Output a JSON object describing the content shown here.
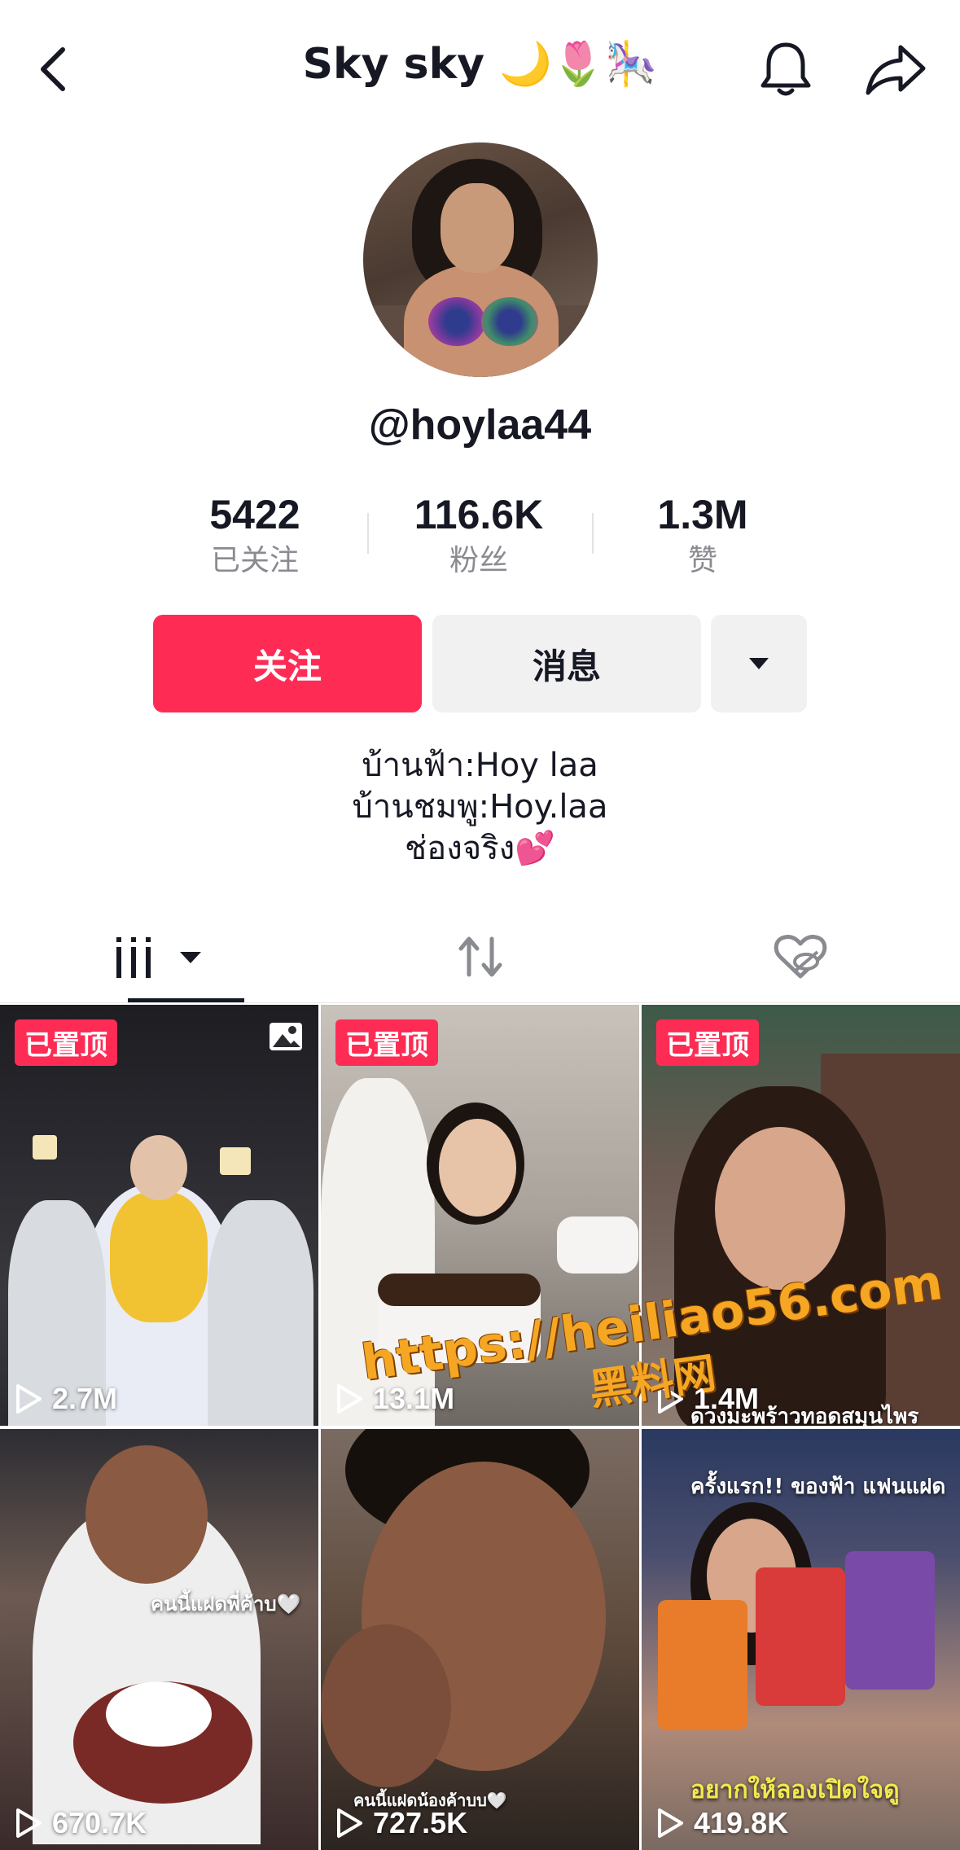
{
  "header": {
    "title": "Sky sky 🌙🌷🎠"
  },
  "profile": {
    "handle": "@hoylaa44",
    "stats": [
      {
        "value": "5422",
        "label": "已关注"
      },
      {
        "value": "116.6K",
        "label": "粉丝"
      },
      {
        "value": "1.3M",
        "label": "赞"
      }
    ],
    "follow_label": "关注",
    "message_label": "消息",
    "bio": [
      "บ้านฟ้า:Hoy laa",
      "บ้านชมพู:Hoy.laa",
      "ช่องจริง💕"
    ]
  },
  "tabs": [
    "videos-grid-icon",
    "repost-icon",
    "liked-private-icon"
  ],
  "videos": [
    {
      "pinned_label": "已置顶",
      "views": "2.7M",
      "type": "photo"
    },
    {
      "pinned_label": "已置顶",
      "views": "13.1M",
      "type": "video"
    },
    {
      "pinned_label": "已置顶",
      "views": "1.4M",
      "type": "video",
      "caption": "ดวงมะพร้าวทอดสมุนไพร"
    },
    {
      "views": "670.7K",
      "type": "video",
      "caption": "คนนี้แฝดพี่ค้าบ🤍"
    },
    {
      "views": "727.5K",
      "type": "video",
      "caption": "คนนี้แฝดน้องค้าบบ🤍"
    },
    {
      "views": "419.8K",
      "type": "video",
      "caption_top": "ครั้งแรก!! ของฟ้า แฟนแฝด",
      "caption_bottom": "อยากให้ลองเปิดใจดู"
    }
  ],
  "watermark": {
    "url": "https://heiliao56.com",
    "name": "黑料网"
  },
  "colors": {
    "accent": "#fe2c55",
    "button_gray": "#f1f1f2",
    "text_primary": "#161823",
    "text_secondary": "#8a8b91"
  }
}
